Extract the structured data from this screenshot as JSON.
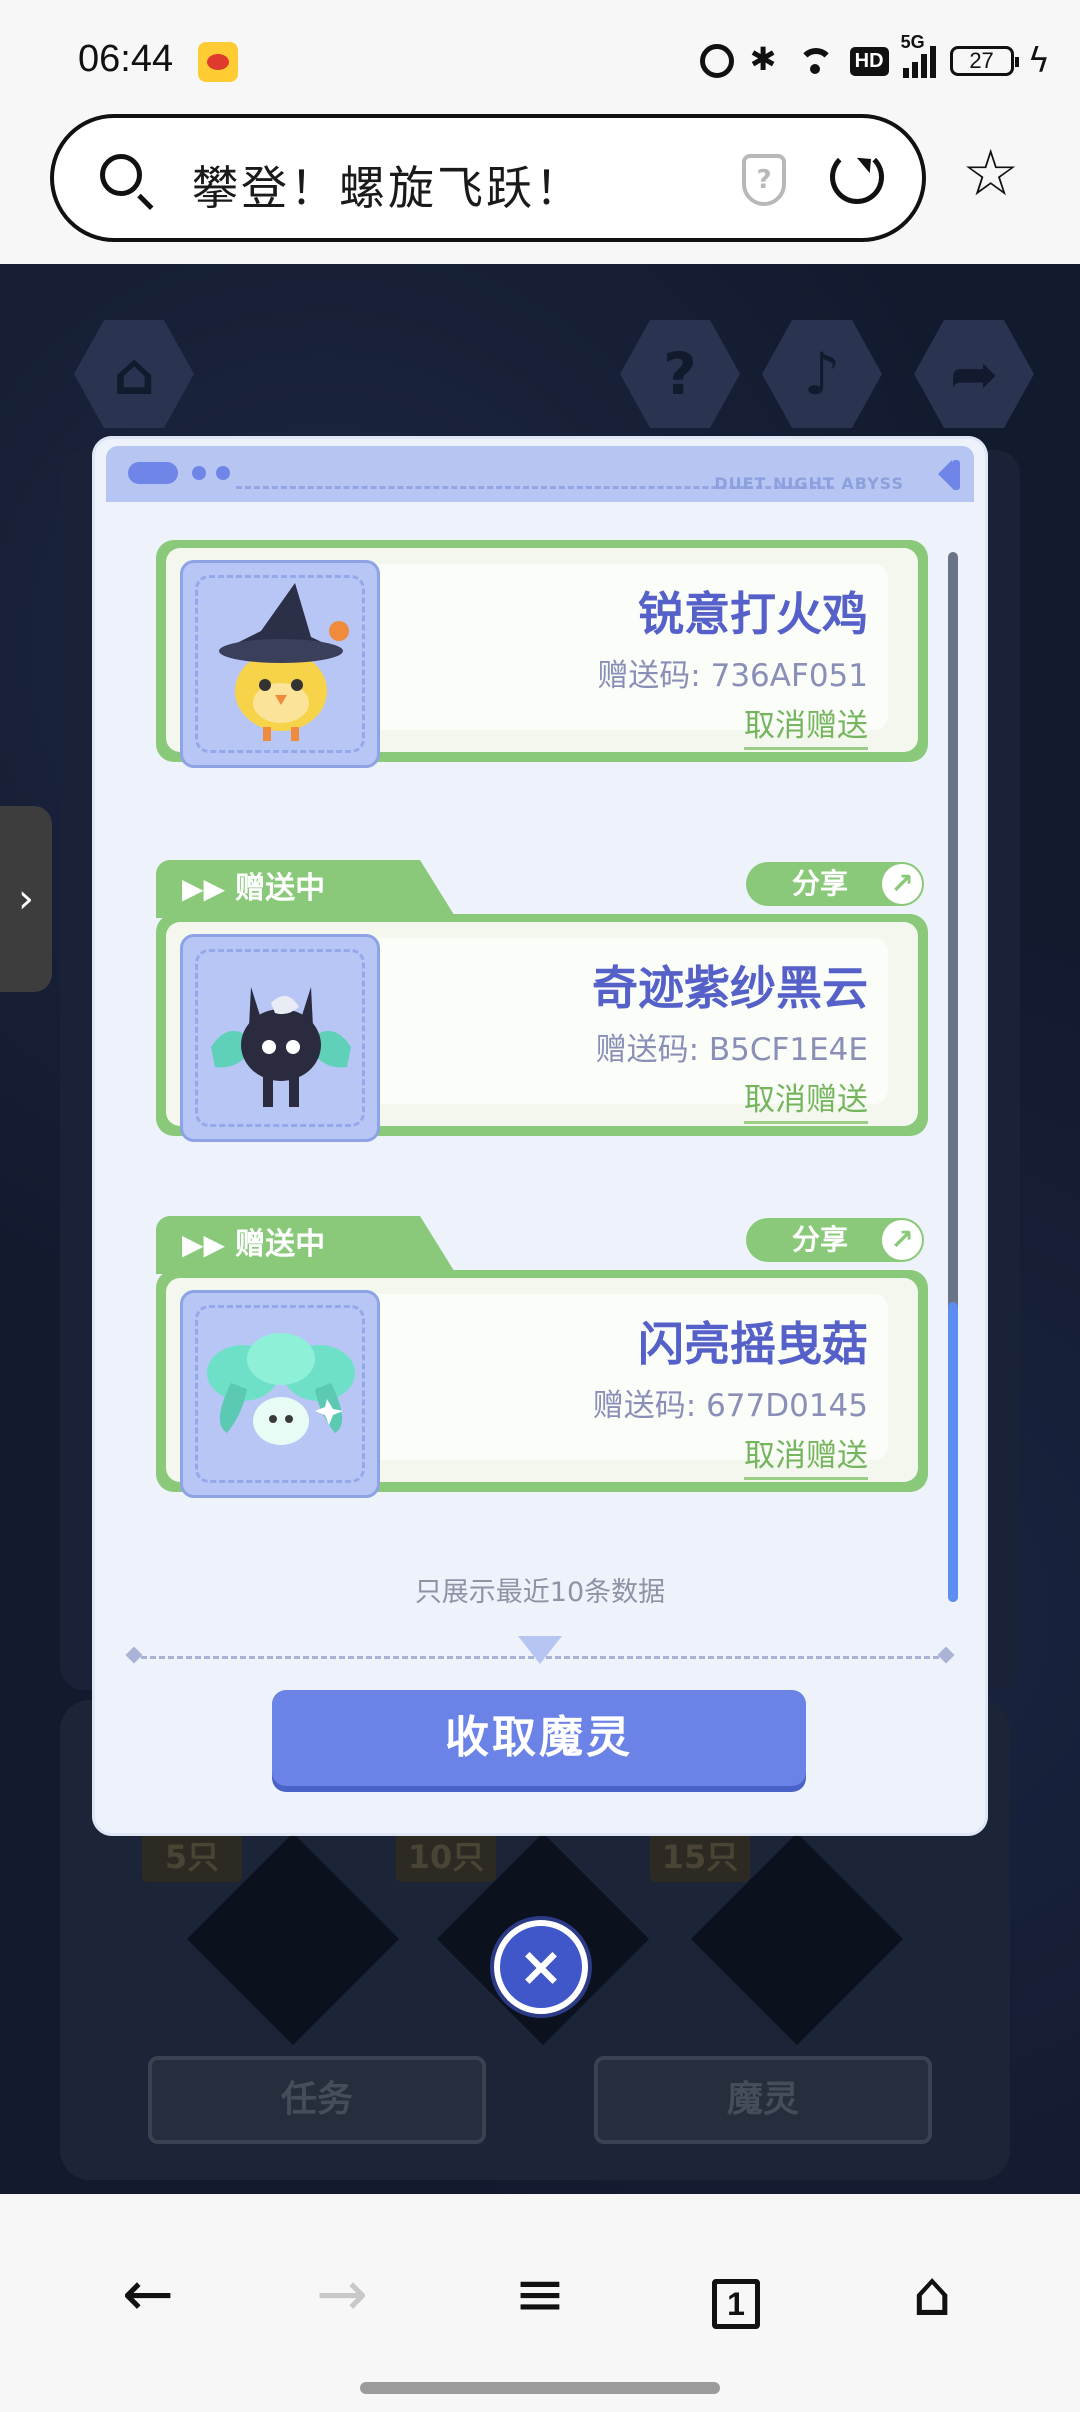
{
  "status_bar": {
    "time": "06:44",
    "network_badge": "HD",
    "signal_label": "5G",
    "battery_level": "27",
    "icons": [
      "weibo-icon",
      "alarm-icon",
      "bluetooth-icon",
      "wifi-icon",
      "signal-icon",
      "battery-icon",
      "charging-bolt-icon"
    ]
  },
  "address_bar": {
    "query": "攀登！螺旋飞跃！",
    "shield_glyph": "?",
    "icons": [
      "search-icon",
      "security-shield-icon",
      "reload-icon",
      "bookmark-star-icon"
    ]
  },
  "game_background": {
    "milestones": [
      "5只",
      "10只",
      "15只"
    ],
    "tabs": [
      "任务",
      "魔灵"
    ]
  },
  "modal": {
    "header_brand": "DUET NIGHT ABYSS",
    "cards": [
      {
        "tab_label": "",
        "share_label": "",
        "name": "锐意打火鸡",
        "code": "赠送码: 736AF051",
        "cancel": "取消赠送"
      },
      {
        "tab_label": "赠送中",
        "share_label": "分享",
        "name": "奇迹紫纱黑云",
        "code": "赠送码: B5CF1E4E",
        "cancel": "取消赠送"
      },
      {
        "tab_label": "赠送中",
        "share_label": "分享",
        "name": "闪亮摇曳菇",
        "code": "赠送码: 677D0145",
        "cancel": "取消赠送"
      }
    ],
    "footer_note": "只展示最近10条数据",
    "collect_button": "收取魔灵"
  },
  "close_button": "×",
  "bottom_nav": {
    "tab_count": "1",
    "icons": [
      "back-arrow-icon",
      "forward-arrow-icon",
      "menu-icon",
      "tabs-icon",
      "home-icon"
    ],
    "forward_enabled": false
  },
  "colors": {
    "card_green": "#8ac97a",
    "title_blue": "#5561c8",
    "button_blue": "#6b83e6",
    "game_bg": "#121a2e"
  }
}
